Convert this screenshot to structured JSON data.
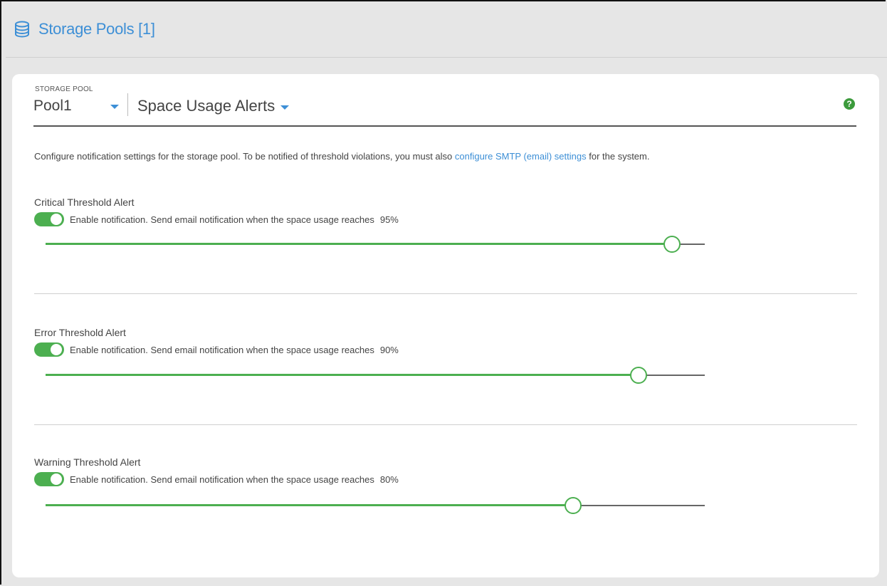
{
  "header": {
    "title": "Storage Pools [1]",
    "icon": "database-icon",
    "accent_color": "#3d8fd6"
  },
  "selector": {
    "pool_label": "STORAGE POOL",
    "pool_value": "Pool1",
    "view_value": "Space Usage Alerts",
    "help_symbol": "?"
  },
  "intro": {
    "text_before": "Configure notification settings for the storage pool. To be notified of threshold violations, you must also ",
    "link_text": "configure SMTP (email) settings",
    "text_after": " for the system."
  },
  "alerts": [
    {
      "title": "Critical Threshold Alert",
      "enabled": true,
      "description": "Enable notification. Send email notification when the space usage reaches",
      "percent_label": "95%",
      "value_percent": 95
    },
    {
      "title": "Error Threshold Alert",
      "enabled": true,
      "description": "Enable notification. Send email notification when the space usage reaches",
      "percent_label": "90%",
      "value_percent": 90
    },
    {
      "title": "Warning Threshold Alert",
      "enabled": true,
      "description": "Enable notification. Send email notification when the space usage reaches",
      "percent_label": "80%",
      "value_percent": 80
    }
  ],
  "colors": {
    "toggle_on": "#4caf50",
    "link": "#3d8fd6"
  }
}
